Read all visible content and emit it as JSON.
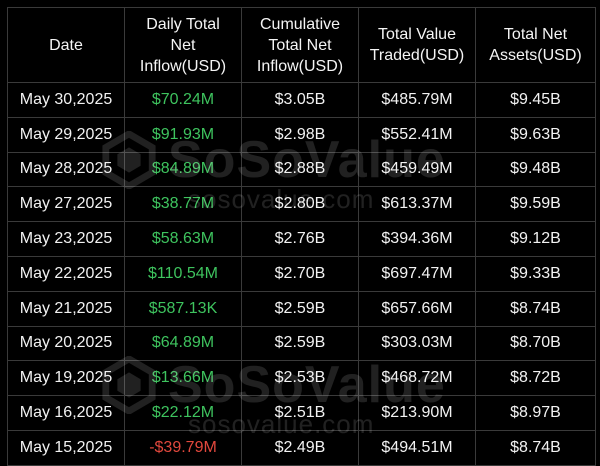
{
  "table": {
    "headers": [
      [
        "Date"
      ],
      [
        "Daily Total",
        "Net",
        "Inflow(USD)"
      ],
      [
        "Cumulative",
        "Total Net",
        "Inflow(USD)"
      ],
      [
        "Total Value",
        "Traded(USD)"
      ],
      [
        "Total Net",
        "Assets(USD)"
      ]
    ],
    "rows": [
      {
        "date": "May 30,2025",
        "daily": "$70.24M",
        "cumulative": "$3.05B",
        "traded": "$485.79M",
        "assets": "$9.45B"
      },
      {
        "date": "May 29,2025",
        "daily": "$91.93M",
        "cumulative": "$2.98B",
        "traded": "$552.41M",
        "assets": "$9.63B"
      },
      {
        "date": "May 28,2025",
        "daily": "$84.89M",
        "cumulative": "$2.88B",
        "traded": "$459.49M",
        "assets": "$9.48B"
      },
      {
        "date": "May 27,2025",
        "daily": "$38.77M",
        "cumulative": "$2.80B",
        "traded": "$613.37M",
        "assets": "$9.59B"
      },
      {
        "date": "May 23,2025",
        "daily": "$58.63M",
        "cumulative": "$2.76B",
        "traded": "$394.36M",
        "assets": "$9.12B"
      },
      {
        "date": "May 22,2025",
        "daily": "$110.54M",
        "cumulative": "$2.70B",
        "traded": "$697.47M",
        "assets": "$9.33B"
      },
      {
        "date": "May 21,2025",
        "daily": "$587.13K",
        "cumulative": "$2.59B",
        "traded": "$657.66M",
        "assets": "$8.74B"
      },
      {
        "date": "May 20,2025",
        "daily": "$64.89M",
        "cumulative": "$2.59B",
        "traded": "$303.03M",
        "assets": "$8.70B"
      },
      {
        "date": "May 19,2025",
        "daily": "$13.66M",
        "cumulative": "$2.53B",
        "traded": "$468.72M",
        "assets": "$8.72B"
      },
      {
        "date": "May 16,2025",
        "daily": "$22.12M",
        "cumulative": "$2.51B",
        "traded": "$213.90M",
        "assets": "$8.97B"
      },
      {
        "date": "May 15,2025",
        "daily": "-$39.79M",
        "cumulative": "$2.49B",
        "traded": "$494.51M",
        "assets": "$8.74B"
      }
    ]
  },
  "watermark": {
    "brand": "SoSoValue",
    "url": "sosovalue.com",
    "icon": "sosovalue-logo-icon"
  },
  "colors": {
    "background": "#000000",
    "text": "#f2f2f2",
    "positive": "#3ec35e",
    "negative": "#e2483d",
    "grid": "#3a3a3a"
  }
}
